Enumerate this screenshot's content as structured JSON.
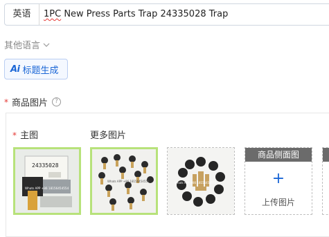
{
  "title_row": {
    "language": "英语",
    "title_value_prefix": "1PC",
    "title_value_rest": " New Press Parts Trap 24335028 Trap"
  },
  "other_languages": {
    "label": "其他语言"
  },
  "ai_button": {
    "icon_text": "Ai",
    "label": "标题生成"
  },
  "product_images": {
    "required_mark": "*",
    "label": "商品图片",
    "help_glyph": "?",
    "main_image": {
      "required_mark": "*",
      "label": "主图",
      "sticker_text": "24335028",
      "watermark": "Whats APP +86 18156454554"
    },
    "more_images": {
      "label": "更多图片",
      "watermark": "Whats APP +86 18156454554"
    },
    "side_image_slot": {
      "header": "商品侧面图",
      "plus_glyph": "+",
      "upload_label": "上传图片"
    }
  },
  "colors": {
    "accent": "#1a66d6",
    "selected_border": "#b7e27a",
    "required": "#e53935",
    "slot_header": "#6b6b6b"
  }
}
